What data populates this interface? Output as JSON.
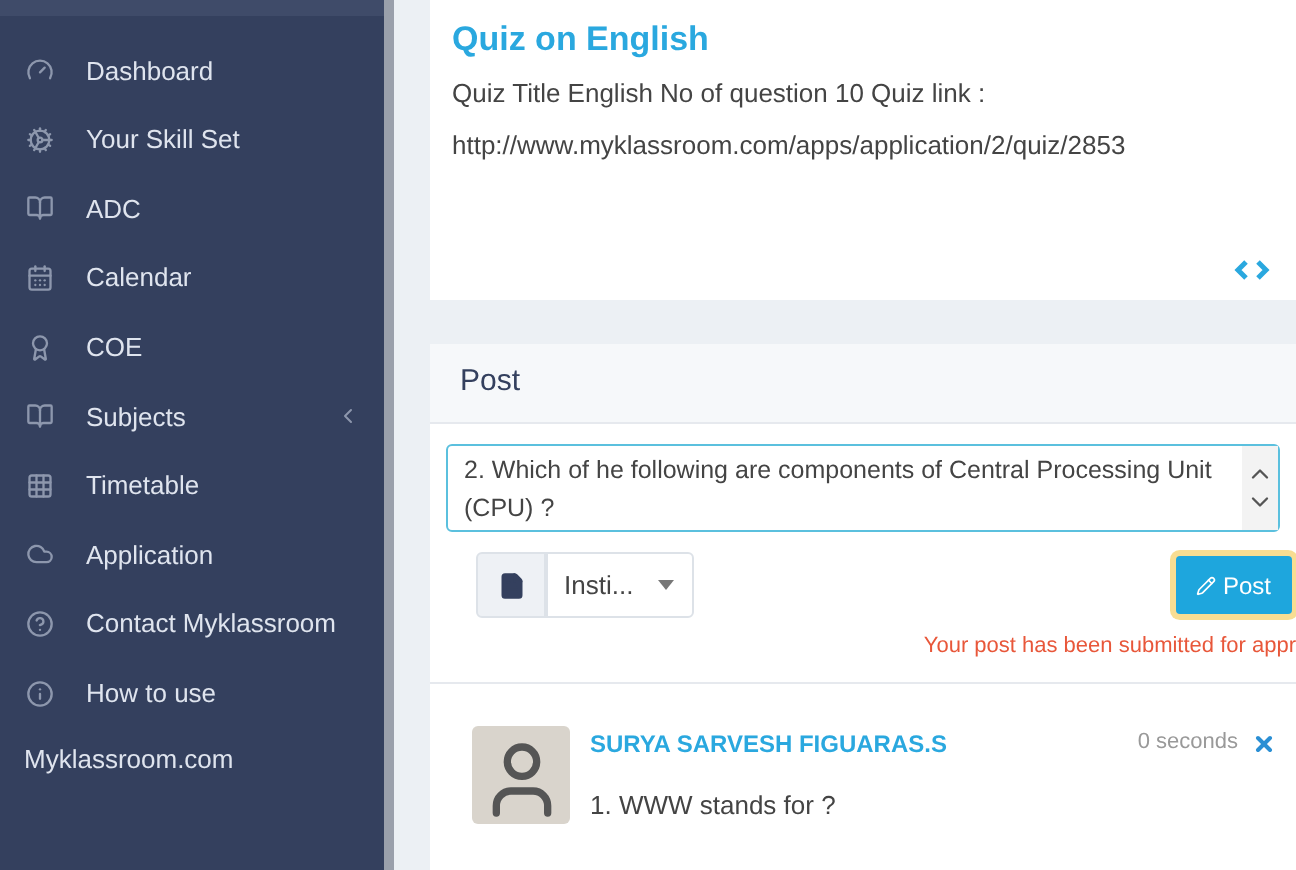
{
  "sidebar": {
    "items": [
      {
        "label": "Dashboard",
        "expandable": false
      },
      {
        "label": "Your Skill Set",
        "expandable": false
      },
      {
        "label": "ADC",
        "expandable": false
      },
      {
        "label": "Calendar",
        "expandable": false
      },
      {
        "label": "COE",
        "expandable": false
      },
      {
        "label": "Subjects",
        "expandable": true
      },
      {
        "label": "Timetable",
        "expandable": false
      },
      {
        "label": "Application",
        "expandable": false
      },
      {
        "label": "Contact Myklassroom",
        "expandable": false
      },
      {
        "label": "How to use",
        "expandable": false
      }
    ],
    "footer": "Myklassroom.com"
  },
  "quiz_card": {
    "title": "Quiz on English",
    "lines": [
      "Quiz Title English No of question 10 Quiz link :",
      "http://www.myklassroom.com/apps/application/2/quiz/2853"
    ]
  },
  "post_card": {
    "title": "Post",
    "input_value": "2. Which of he following are components of Central Processing Unit (CPU) ?",
    "audience": "Insti...",
    "button": "Post",
    "message": "Your post has been submitted for appr",
    "comments": [
      {
        "author": "SURYA SARVESH FIGUARAS.S",
        "time": "0 seconds",
        "text": "1. WWW stands for ?"
      }
    ]
  }
}
